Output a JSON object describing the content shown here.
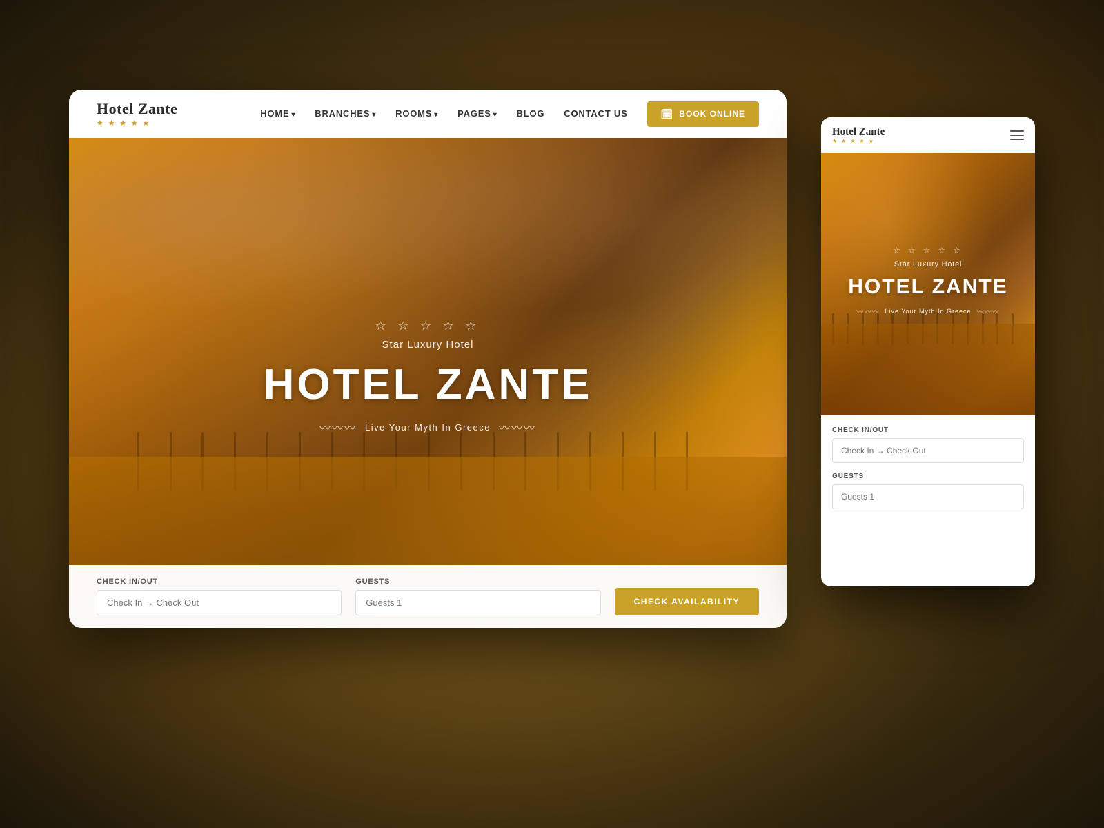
{
  "background": {
    "color": "#5C3A10"
  },
  "desktop": {
    "nav": {
      "logo": {
        "name": "Hotel Zante",
        "stars": "★ ★ ★ ★ ★"
      },
      "links": [
        {
          "label": "HOME",
          "has_dropdown": true
        },
        {
          "label": "BRANCHES",
          "has_dropdown": true
        },
        {
          "label": "ROOMS",
          "has_dropdown": true
        },
        {
          "label": "PAGES",
          "has_dropdown": true
        },
        {
          "label": "BLOG",
          "has_dropdown": false
        },
        {
          "label": "CONTACT US",
          "has_dropdown": false
        }
      ],
      "book_button": "BOOK ONLINE"
    },
    "hero": {
      "stars": "☆ ☆ ☆ ☆ ☆",
      "subtitle": "Star Luxury Hotel",
      "title": "HOTEL ZANTE",
      "tagline": "Live Your Myth In Greece",
      "wave_left": "〰〰〰",
      "wave_right": "〰〰〰"
    },
    "booking": {
      "checkinout_label": "Check In/Out",
      "checkinout_placeholder": "Check In → Check Out",
      "guests_label": "Guests",
      "guests_placeholder": "Guests 1",
      "button_label": "CHECK AVAILABILITY"
    }
  },
  "mobile": {
    "nav": {
      "logo": {
        "name": "Hotel Zante",
        "stars": "★ ★ ★ ★ ★"
      },
      "menu_icon": "≡"
    },
    "hero": {
      "stars": "☆ ☆ ☆ ☆ ☆",
      "subtitle": "Star Luxury Hotel",
      "title": "HOTEL ZANTE",
      "tagline": "Live Your Myth In Greece",
      "wave_left": "〰〰〰",
      "wave_right": "〰〰〰"
    },
    "booking": {
      "checkinout_label": "Check In/Out",
      "checkinout_placeholder": "Check In → Check Out",
      "guests_label": "Guests",
      "guests_placeholder": "Guests 1"
    }
  }
}
